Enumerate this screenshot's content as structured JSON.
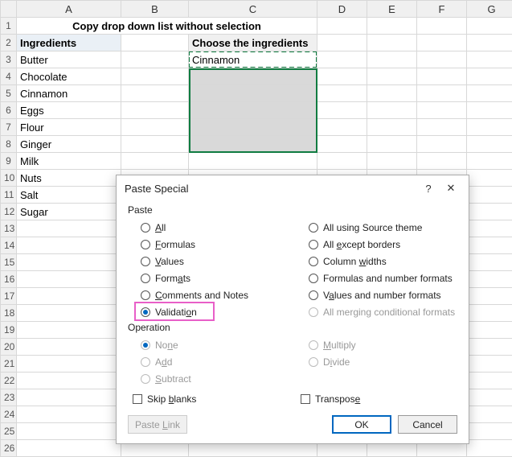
{
  "columns": [
    "A",
    "B",
    "C",
    "D",
    "E",
    "F",
    "G"
  ],
  "rows": [
    "1",
    "2",
    "3",
    "4",
    "5",
    "6",
    "7",
    "8",
    "9",
    "10",
    "11",
    "12",
    "13",
    "14",
    "15",
    "16",
    "17",
    "18",
    "19",
    "20",
    "21",
    "22",
    "23",
    "24",
    "25",
    "26"
  ],
  "title": "Copy drop down list without selection",
  "header_ingredients": "Ingredients",
  "header_choose": "Choose the ingredients",
  "c3_value": "Cinnamon",
  "ingredients": [
    "Butter",
    "Chocolate",
    "Cinnamon",
    "Eggs",
    "Flour",
    "Ginger",
    "Milk",
    "Nuts",
    "Salt",
    "Sugar"
  ],
  "dialog": {
    "title": "Paste Special",
    "help_glyph": "?",
    "close_glyph": "✕",
    "group_paste": "Paste",
    "paste_left": [
      {
        "key": "all",
        "label": "All",
        "u": 0
      },
      {
        "key": "formulas",
        "label": "Formulas",
        "u": 0
      },
      {
        "key": "values",
        "label": "Values",
        "u": 0
      },
      {
        "key": "formats",
        "label": "Formats",
        "u": 4
      },
      {
        "key": "comments",
        "label": "Comments and Notes",
        "u": 0
      },
      {
        "key": "validation",
        "label": "Validation",
        "u": 8,
        "selected": true
      }
    ],
    "paste_right": [
      {
        "key": "all-theme",
        "label": "All using Source theme"
      },
      {
        "key": "all-except-borders",
        "label": "All except borders",
        "u": 4,
        "uc": "x"
      },
      {
        "key": "col-widths",
        "label": "Column widths",
        "u": 7
      },
      {
        "key": "formulas-num",
        "label": "Formulas and number formats"
      },
      {
        "key": "values-num",
        "label": "Values and number formats",
        "u": 1
      },
      {
        "key": "all-merge-cond",
        "label": "All merging conditional formats",
        "disabled": true
      }
    ],
    "group_operation": "Operation",
    "op_left": [
      {
        "key": "none",
        "label": "None",
        "u": 2,
        "disabled": true,
        "selected": true
      },
      {
        "key": "add",
        "label": "Add",
        "u": 1,
        "disabled": true
      },
      {
        "key": "subtract",
        "label": "Subtract",
        "u": 0,
        "disabled": true
      }
    ],
    "op_right": [
      {
        "key": "multiply",
        "label": "Multiply",
        "u": 0,
        "disabled": true
      },
      {
        "key": "divide",
        "label": "Divide",
        "u": 1,
        "disabled": true
      }
    ],
    "skip_blanks": "Skip blanks",
    "transpose": "Transpose",
    "paste_link": "Paste Link",
    "ok": "OK",
    "cancel": "Cancel"
  }
}
